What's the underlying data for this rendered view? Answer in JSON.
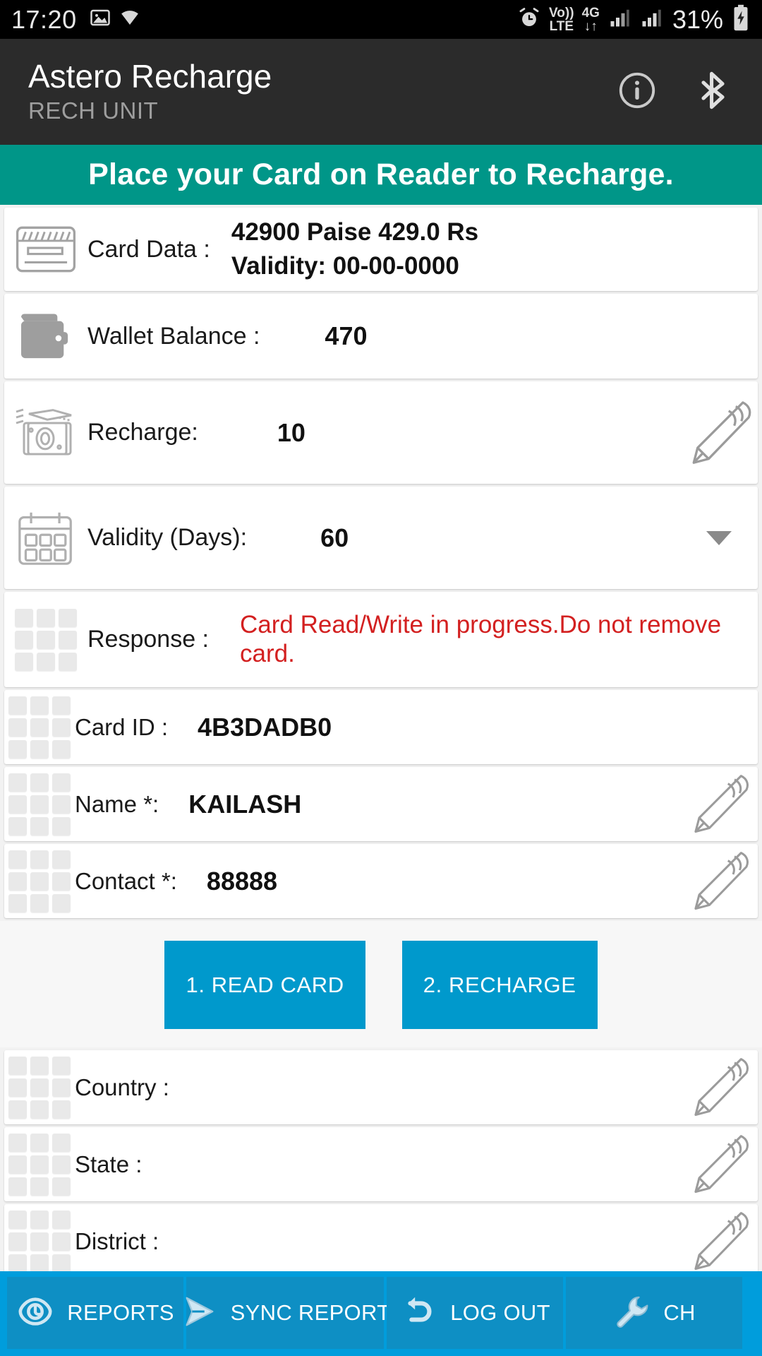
{
  "status_bar": {
    "time": "17:20",
    "left_icons": [
      "image-icon",
      "wifi-icon"
    ],
    "alarm_icon": "alarm-icon",
    "volte_top": "Vo))",
    "volte_bottom": "LTE",
    "network_type": "4G",
    "data_arrows": "↓↑",
    "signal_bars_1": "signal-bars-icon",
    "signal_bars_2": "signal-bars-icon",
    "battery_percent": "31%",
    "battery_icon": "battery-charging-icon"
  },
  "app_bar": {
    "title": "Astero Recharge",
    "subtitle": "RECH UNIT",
    "info_icon": "info-icon",
    "bluetooth_icon": "bluetooth-icon"
  },
  "banner": {
    "text": "Place your Card on Reader to Recharge.",
    "color": "#009688"
  },
  "rows": {
    "card_data": {
      "label": "Card Data :",
      "icon": "credit-card-icon",
      "line1": "42900 Paise 429.0 Rs",
      "line2": "Validity: 00-00-0000"
    },
    "wallet_balance": {
      "label": "Wallet Balance :",
      "icon": "wallet-icon",
      "value": "470"
    },
    "recharge": {
      "label": "Recharge:",
      "icon": "cash-icon",
      "value": "10",
      "edit_icon": "pencil-icon"
    },
    "validity": {
      "label": "Validity (Days):",
      "icon": "calendar-icon",
      "value": "60",
      "dropdown_icon": "chevron-down-icon"
    },
    "response": {
      "label": "Response :",
      "icon": "grid-placeholder-icon",
      "value": "Card Read/Write in progress.Do not remove card.",
      "value_color": "#d32020"
    },
    "card_id": {
      "label": "Card ID :",
      "icon": "grid-placeholder-icon",
      "value": "4B3DADB0"
    },
    "name": {
      "label": "Name *:",
      "icon": "grid-placeholder-icon",
      "value": "KAILASH",
      "edit_icon": "pencil-icon"
    },
    "contact": {
      "label": "Contact *:",
      "icon": "grid-placeholder-icon",
      "value": "88888",
      "edit_icon": "pencil-icon"
    },
    "country": {
      "label": "Country :",
      "icon": "grid-placeholder-icon",
      "value": "",
      "edit_icon": "pencil-icon"
    },
    "state": {
      "label": "State :",
      "icon": "grid-placeholder-icon",
      "value": "",
      "edit_icon": "pencil-icon"
    },
    "district": {
      "label": "District :",
      "icon": "grid-placeholder-icon",
      "value": "",
      "edit_icon": "pencil-icon"
    }
  },
  "buttons": {
    "read_card": "1. READ CARD",
    "recharge": "2. RECHARGE",
    "color": "#0099cc"
  },
  "bottom_nav": {
    "background": "#009ddc",
    "items": [
      {
        "label": "REPORTS",
        "icon": "eye-icon"
      },
      {
        "label": "SYNC REPORT",
        "icon": "send-arrow-icon"
      },
      {
        "label": "LOG OUT",
        "icon": "undo-arrow-icon"
      },
      {
        "label": "CH",
        "icon": "wrench-icon"
      }
    ]
  }
}
